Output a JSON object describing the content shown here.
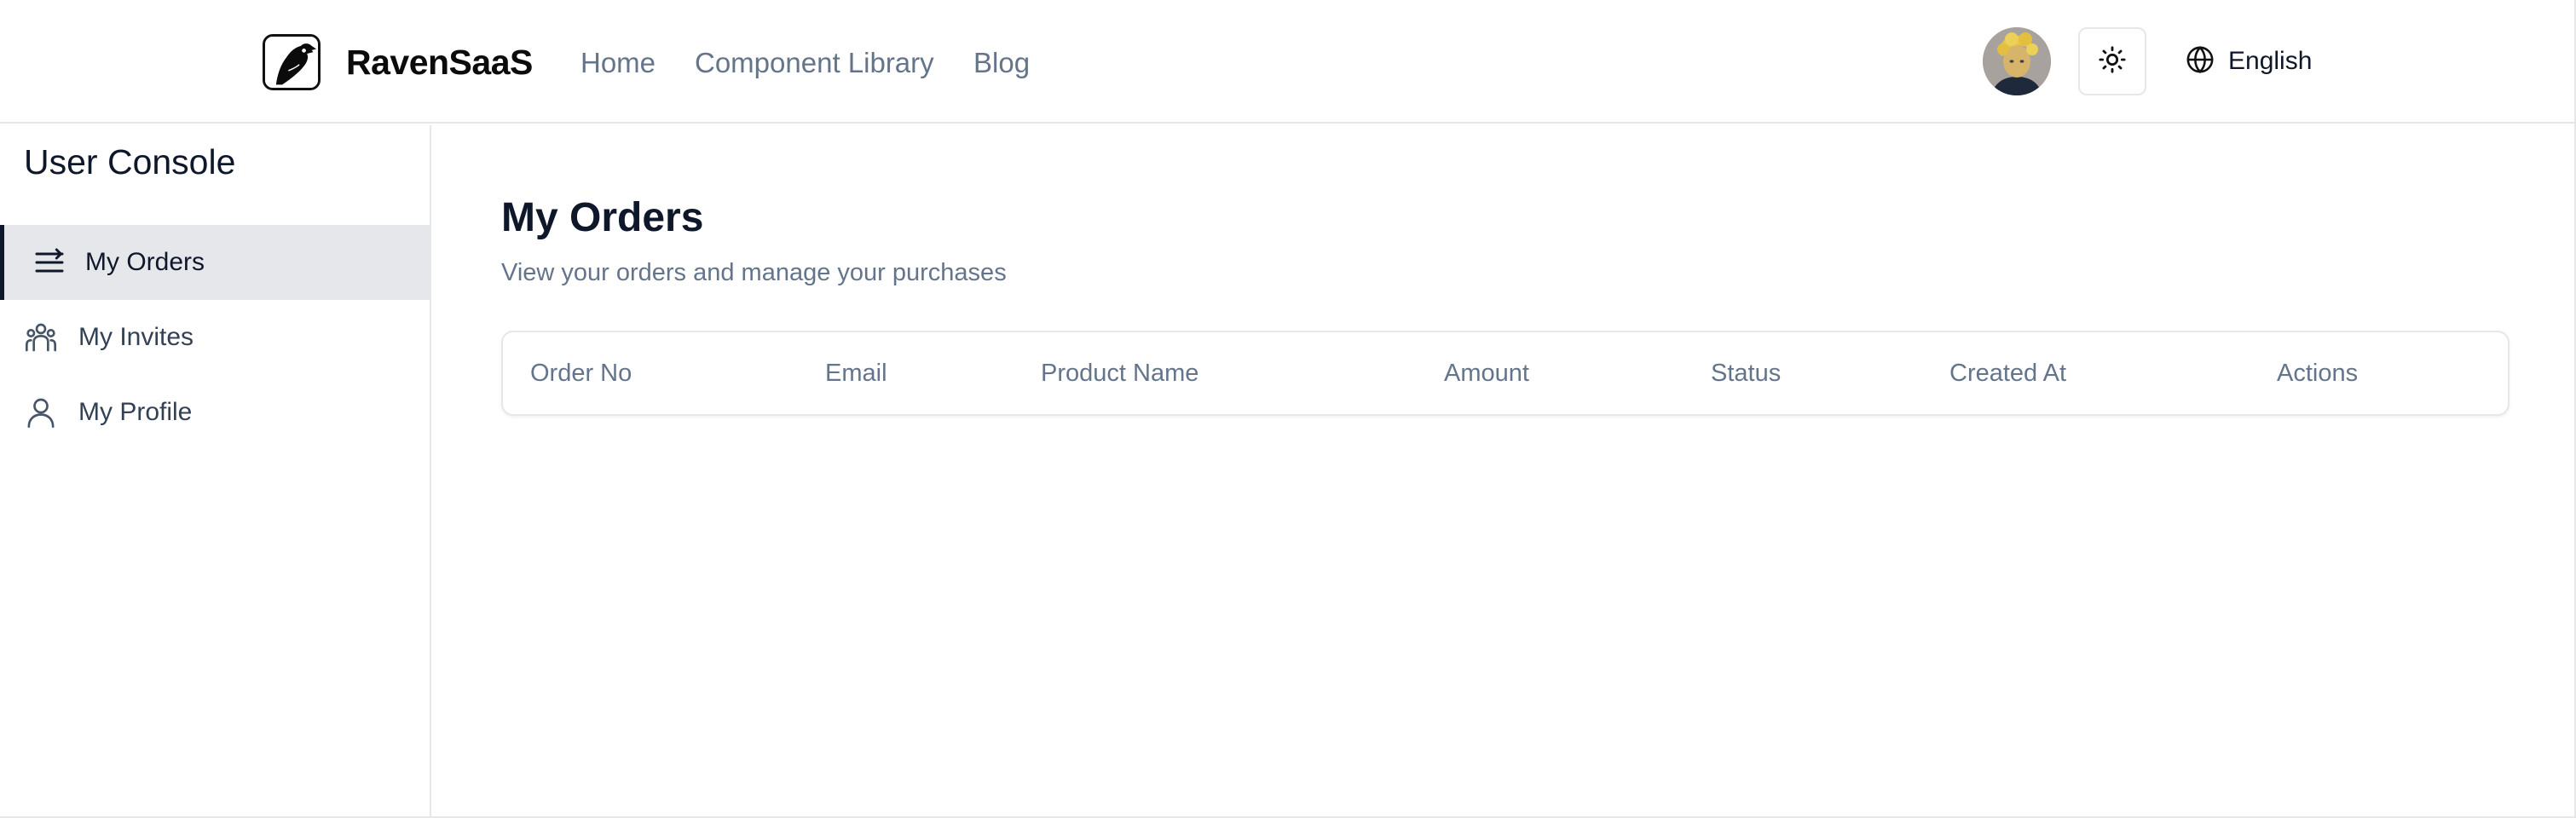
{
  "header": {
    "brand": "RavenSaaS",
    "nav": [
      {
        "label": "Home"
      },
      {
        "label": "Component Library"
      },
      {
        "label": "Blog"
      }
    ],
    "language": "English",
    "icons": {
      "logo": "raven-logo",
      "avatar": "user-avatar",
      "theme": "sun-icon",
      "language": "globe-icon"
    }
  },
  "sidebar": {
    "title": "User Console",
    "items": [
      {
        "label": "My Orders",
        "icon": "list-icon",
        "active": true
      },
      {
        "label": "My Invites",
        "icon": "users-icon",
        "active": false
      },
      {
        "label": "My Profile",
        "icon": "user-icon",
        "active": false
      }
    ]
  },
  "main": {
    "title": "My Orders",
    "subtitle": "View your orders and manage your purchases",
    "table": {
      "columns": [
        "Order No",
        "Email",
        "Product Name",
        "Amount",
        "Status",
        "Created At",
        "Actions"
      ],
      "rows": []
    }
  },
  "colors": {
    "text_primary": "#0f172a",
    "text_muted": "#64748b",
    "border": "#e5e7eb",
    "active_bg": "#e5e7eb"
  }
}
